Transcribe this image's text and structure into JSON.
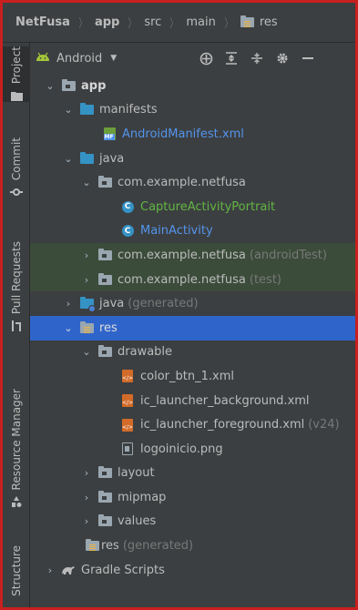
{
  "breadcrumb": {
    "items": [
      "NetFusa",
      "app",
      "src",
      "main",
      "res"
    ],
    "separator": "〉"
  },
  "tool_strip": {
    "items": [
      {
        "label": "Project",
        "icon": "folder-icon",
        "active": true
      },
      {
        "label": "Commit",
        "icon": "commit-icon",
        "active": false
      },
      {
        "label": "Pull Requests",
        "icon": "pull-request-icon",
        "active": false
      },
      {
        "label": "Resource Manager",
        "icon": "resource-manager-icon",
        "active": false
      },
      {
        "label": "Structure",
        "icon": "structure-icon",
        "active": false
      }
    ]
  },
  "panel": {
    "view_selector": "Android",
    "toolbar_icons": [
      "crosshair-icon",
      "expand-all-icon",
      "collapse-all-icon",
      "gear-icon",
      "minimize-icon"
    ]
  },
  "tree": [
    {
      "label": "app",
      "indent": 0,
      "expanded": true,
      "icon": "module-folder-icon",
      "style": "bold"
    },
    {
      "label": "manifests",
      "indent": 1,
      "expanded": true,
      "icon": "folder-blue-icon"
    },
    {
      "label": "AndroidManifest.xml",
      "indent": 2,
      "expanded": null,
      "icon": "manifest-file-icon",
      "style": "blue"
    },
    {
      "label": "java",
      "indent": 1,
      "expanded": true,
      "icon": "folder-blue-icon"
    },
    {
      "label": "com.example.netfusa",
      "indent": 2,
      "expanded": true,
      "icon": "package-icon"
    },
    {
      "label": "CaptureActivityPortrait",
      "indent": 3,
      "expanded": null,
      "icon": "class-icon",
      "style": "green"
    },
    {
      "label": "MainActivity",
      "indent": 3,
      "expanded": null,
      "icon": "class-icon",
      "style": "blue"
    },
    {
      "label": "com.example.netfusa",
      "suffix": "(androidTest)",
      "indent": 2,
      "expanded": false,
      "icon": "package-icon",
      "row": "green"
    },
    {
      "label": "com.example.netfusa",
      "suffix": "(test)",
      "indent": 2,
      "expanded": false,
      "icon": "package-icon",
      "row": "green"
    },
    {
      "label": "java",
      "suffix": "(generated)",
      "indent": 1,
      "expanded": false,
      "icon": "generated-folder-icon"
    },
    {
      "label": "res",
      "indent": 1,
      "expanded": true,
      "icon": "res-folder-icon",
      "row": "selected"
    },
    {
      "label": "drawable",
      "indent": 2,
      "expanded": true,
      "icon": "package-icon"
    },
    {
      "label": "color_btn_1.xml",
      "indent": 3,
      "expanded": null,
      "icon": "xml-file-icon"
    },
    {
      "label": "ic_launcher_background.xml",
      "indent": 3,
      "expanded": null,
      "icon": "xml-file-icon"
    },
    {
      "label": "ic_launcher_foreground.xml",
      "suffix": "(v24)",
      "indent": 3,
      "expanded": null,
      "icon": "xml-file-icon"
    },
    {
      "label": "logoinicio.png",
      "indent": 3,
      "expanded": null,
      "icon": "image-file-icon"
    },
    {
      "label": "layout",
      "indent": 2,
      "expanded": false,
      "icon": "package-icon"
    },
    {
      "label": "mipmap",
      "indent": 2,
      "expanded": false,
      "icon": "package-icon"
    },
    {
      "label": "values",
      "indent": 2,
      "expanded": false,
      "icon": "package-icon"
    },
    {
      "label": "res",
      "suffix": "(generated)",
      "indent": 1,
      "expanded": null,
      "icon": "res-folder-icon"
    },
    {
      "label": "Gradle Scripts",
      "indent": 0,
      "expanded": false,
      "icon": "gradle-icon"
    }
  ],
  "colors": {
    "frame_border": "#c8201f",
    "selection": "#2f65ca",
    "test_row": "#3b4c3a",
    "link_blue": "#5394ec",
    "class_green": "#62b543"
  }
}
